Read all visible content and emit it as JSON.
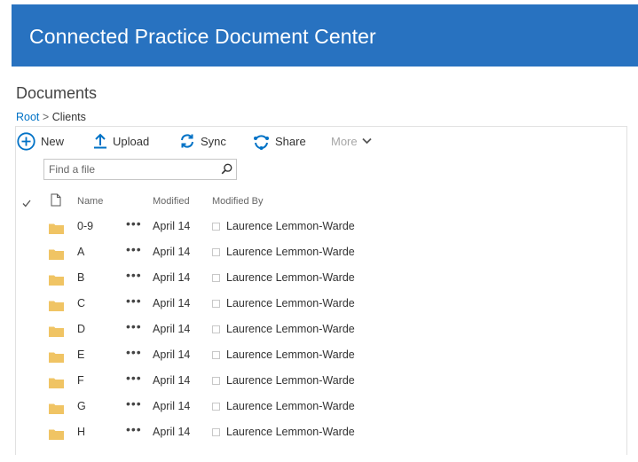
{
  "header": {
    "title": "Connected Practice Document Center",
    "background": "#2872c0"
  },
  "page": {
    "title": "Documents"
  },
  "breadcrumb": {
    "root": "Root",
    "separator": ">",
    "current": "Clients"
  },
  "toolbar": {
    "new_label": "New",
    "upload_label": "Upload",
    "sync_label": "Sync",
    "share_label": "Share",
    "more_label": "More"
  },
  "search": {
    "placeholder": "Find a file",
    "value": ""
  },
  "columns": {
    "name": "Name",
    "modified": "Modified",
    "modified_by": "Modified By"
  },
  "rows": [
    {
      "name": "0-9",
      "modified": "April 14",
      "modified_by": "Laurence Lemmon-Warde"
    },
    {
      "name": "A",
      "modified": "April 14",
      "modified_by": "Laurence Lemmon-Warde"
    },
    {
      "name": "B",
      "modified": "April 14",
      "modified_by": "Laurence Lemmon-Warde"
    },
    {
      "name": "C",
      "modified": "April 14",
      "modified_by": "Laurence Lemmon-Warde"
    },
    {
      "name": "D",
      "modified": "April 14",
      "modified_by": "Laurence Lemmon-Warde"
    },
    {
      "name": "E",
      "modified": "April 14",
      "modified_by": "Laurence Lemmon-Warde"
    },
    {
      "name": "F",
      "modified": "April 14",
      "modified_by": "Laurence Lemmon-Warde"
    },
    {
      "name": "G",
      "modified": "April 14",
      "modified_by": "Laurence Lemmon-Warde"
    },
    {
      "name": "H",
      "modified": "April 14",
      "modified_by": "Laurence Lemmon-Warde"
    }
  ],
  "row_ellipsis": "•••",
  "colors": {
    "accent": "#0072c6",
    "folder": "#f0c464"
  }
}
